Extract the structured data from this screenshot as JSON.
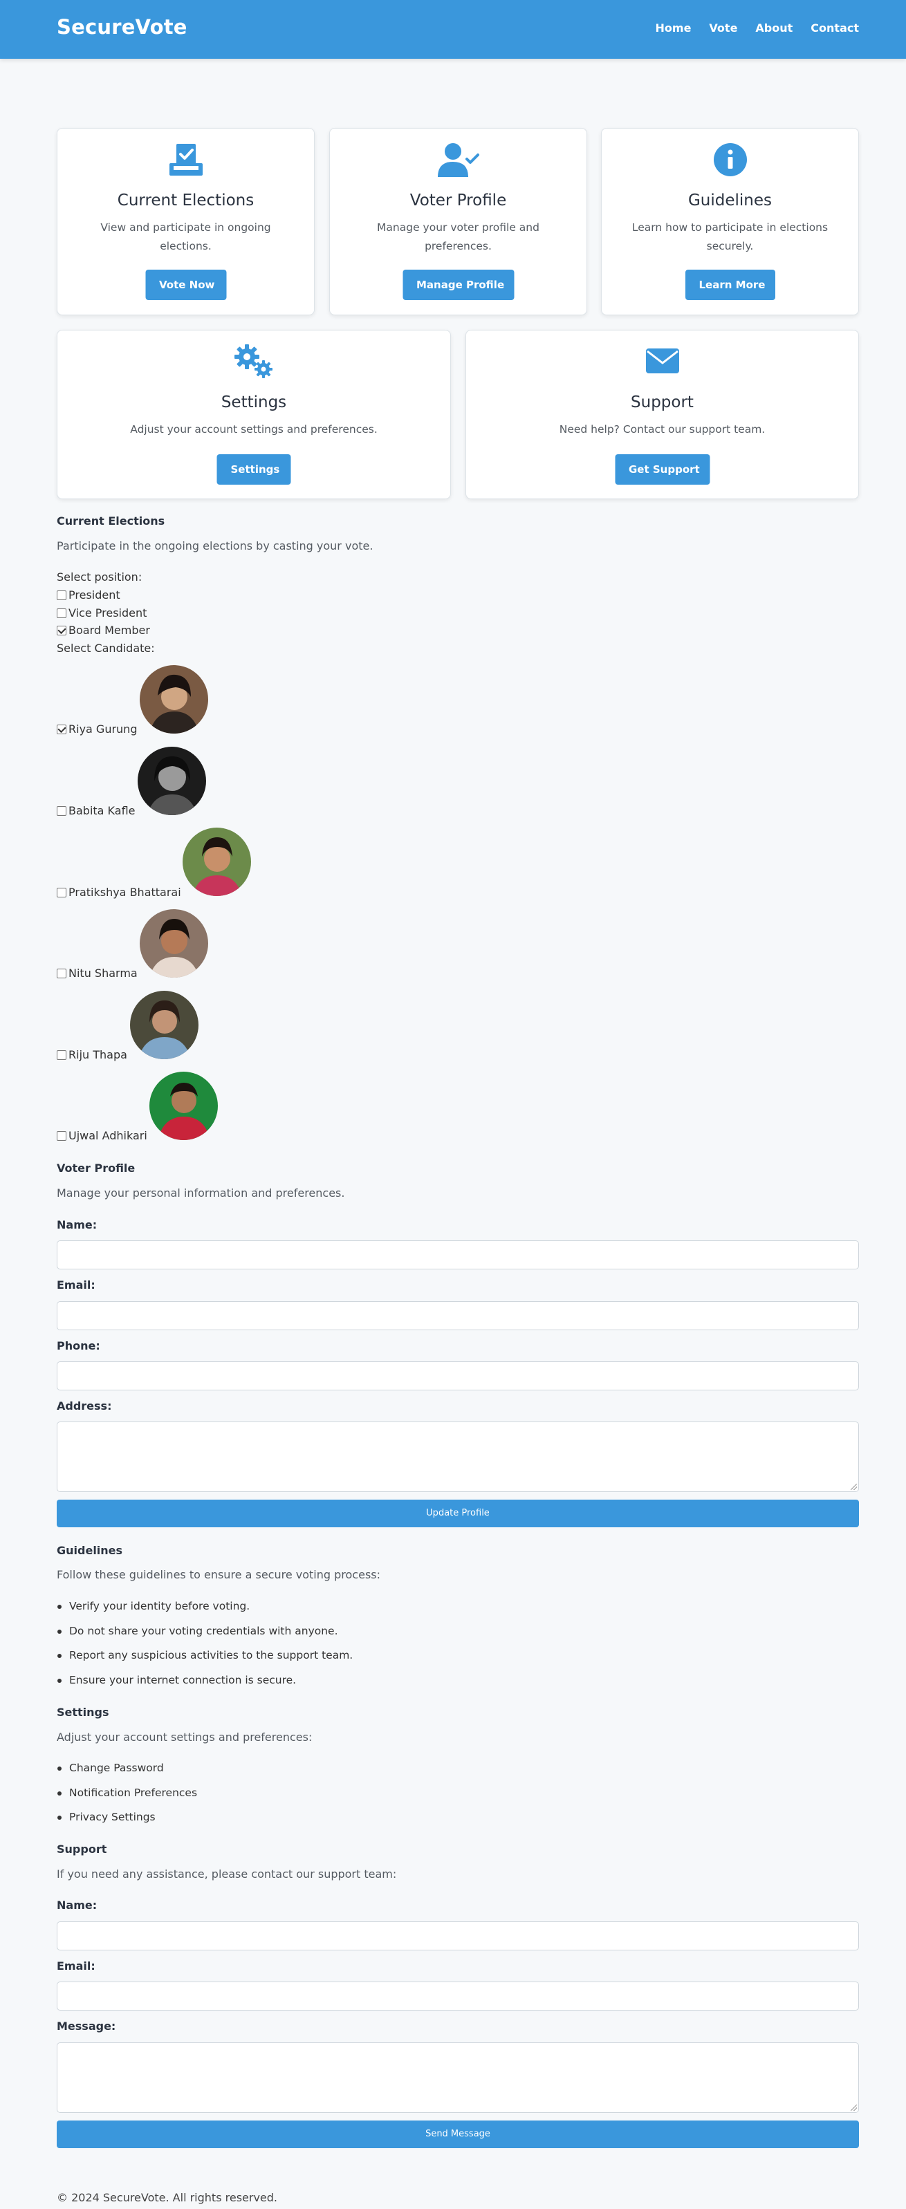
{
  "header": {
    "brand": "SecureVote",
    "nav": [
      "Home",
      "Vote",
      "About",
      "Contact"
    ]
  },
  "cards": [
    {
      "icon": "ballot-box-check-icon",
      "title": "Current Elections",
      "desc": "View and participate in ongoing elections.",
      "button": "Vote Now"
    },
    {
      "icon": "user-check-icon",
      "title": "Voter Profile",
      "desc": "Manage your voter profile and preferences.",
      "button": "Manage Profile"
    },
    {
      "icon": "info-circle-icon",
      "title": "Guidelines",
      "desc": "Learn how to participate in elections securely.",
      "button": "Learn More"
    },
    {
      "icon": "gears-icon",
      "title": "Settings",
      "desc": "Adjust your account settings and preferences.",
      "button": "Settings"
    },
    {
      "icon": "envelope-icon",
      "title": "Support",
      "desc": "Need help? Contact our support team.",
      "button": "Get Support"
    }
  ],
  "elections": {
    "title": "Current Elections",
    "desc": "Participate in the ongoing elections by casting your vote.",
    "position_label": "Select position:",
    "positions": [
      {
        "label": "President",
        "checked": false
      },
      {
        "label": "Vice President",
        "checked": false
      },
      {
        "label": "Board Member",
        "checked": true
      }
    ],
    "candidate_label": "Select Candidate:",
    "candidates": [
      {
        "name": "Riya Gurung",
        "checked": true
      },
      {
        "name": "Babita Kafle",
        "checked": false
      },
      {
        "name": "Pratikshya Bhattarai",
        "checked": false
      },
      {
        "name": "Nitu Sharma",
        "checked": false
      },
      {
        "name": "Riju Thapa",
        "checked": false
      },
      {
        "name": "Ujwal Adhikari",
        "checked": false
      }
    ]
  },
  "profile": {
    "title": "Voter Profile",
    "desc": "Manage your personal information and preferences.",
    "name_label": "Name:",
    "email_label": "Email:",
    "phone_label": "Phone:",
    "address_label": "Address:",
    "name_value": "",
    "email_value": "",
    "phone_value": "",
    "address_value": "",
    "button": "Update Profile"
  },
  "guidelines": {
    "title": "Guidelines",
    "desc": "Follow these guidelines to ensure a secure voting process:",
    "items": [
      "Verify your identity before voting.",
      "Do not share your voting credentials with anyone.",
      "Report any suspicious activities to the support team.",
      "Ensure your internet connection is secure."
    ]
  },
  "settings": {
    "title": "Settings",
    "desc": "Adjust your account settings and preferences:",
    "items": [
      "Change Password",
      "Notification Preferences",
      "Privacy Settings"
    ]
  },
  "support": {
    "title": "Support",
    "desc": "If you need any assistance, please contact our support team:",
    "name_label": "Name:",
    "email_label": "Email:",
    "message_label": "Message:",
    "name_value": "",
    "email_value": "",
    "message_value": "",
    "button": "Send Message"
  },
  "footer": "© 2024 SecureVote. All rights reserved.",
  "colors": {
    "accent": "#3a97dc",
    "background": "#f6f8fa",
    "text": "#2b3340"
  }
}
